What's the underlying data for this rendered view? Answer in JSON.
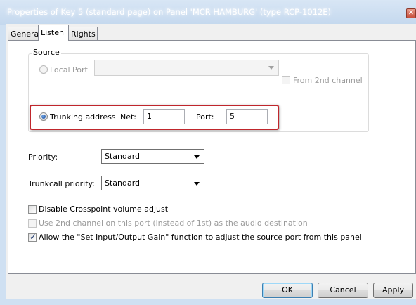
{
  "window": {
    "title": "Properties of Key 5 (standard page) on Panel 'MCR HAMBURG' (type RCP-1012E)",
    "close_glyph": "✕"
  },
  "tabs": [
    {
      "label": "General",
      "active": false
    },
    {
      "label": "Listen",
      "active": true
    },
    {
      "label": "Rights",
      "active": false
    }
  ],
  "source": {
    "group_label": "Source",
    "local_port": {
      "label": "Local Port",
      "selected": false,
      "value": ""
    },
    "from_2nd_channel": {
      "label": "From 2nd channel",
      "checked": false,
      "enabled": false
    },
    "trunking": {
      "label": "Trunking address",
      "selected": true,
      "net_label": "Net:",
      "net_value": "1",
      "port_label": "Port:",
      "port_value": "5"
    }
  },
  "priority": {
    "label": "Priority:",
    "value": "Standard"
  },
  "trunkcall_priority": {
    "label": "Trunkcall priority:",
    "value": "Standard"
  },
  "options": [
    {
      "label": "Disable Crosspoint volume adjust",
      "checked": false,
      "enabled": true
    },
    {
      "label": "Use 2nd channel on this port (instead of 1st) as the audio destination",
      "checked": false,
      "enabled": false
    },
    {
      "label": "Allow the \"Set Input/Output Gain\" function to adjust the source port from this panel",
      "checked": true,
      "enabled": true
    }
  ],
  "buttons": {
    "ok": "OK",
    "cancel": "Cancel",
    "apply": "Apply"
  },
  "colors": {
    "highlight": "#c0262c",
    "title_bar": "#cfe0f2",
    "radio_dot": "#1d4c9a"
  }
}
